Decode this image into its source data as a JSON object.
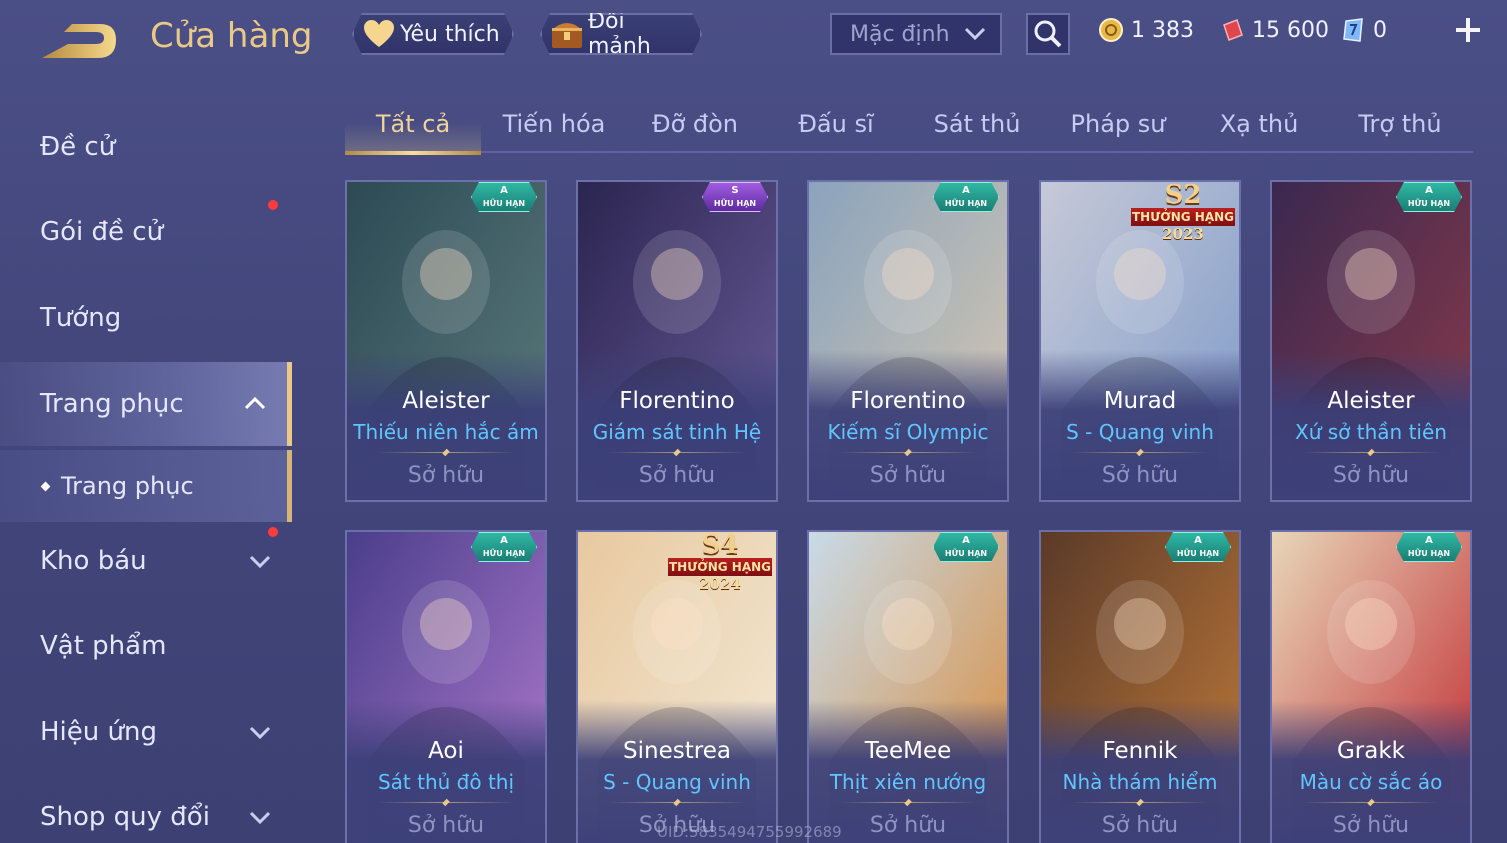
{
  "header": {
    "title": "Cửa hàng",
    "favorites_label": "Yêu thích",
    "exchange_label": "Đổi mảnh",
    "sort_value": "Mặc định",
    "currencies": [
      {
        "name": "gold-coin",
        "value": "1 383",
        "color": "#e8b84a"
      },
      {
        "name": "red-voucher",
        "value": "15 600",
        "color": "#e0464e"
      },
      {
        "name": "blue-gem",
        "value": "0",
        "color": "#7fb8ff"
      }
    ]
  },
  "sidebar": {
    "items": [
      {
        "label": "Đề cử"
      },
      {
        "label": "Gói đề cử",
        "dot": true
      },
      {
        "label": "Tướng"
      },
      {
        "label": "Trang phục",
        "expanded": true
      },
      {
        "label": "Trang phục",
        "sub": true
      },
      {
        "label": "Kho báu",
        "dot": true
      },
      {
        "label": "Vật phẩm"
      },
      {
        "label": "Hiệu ứng"
      },
      {
        "label": "Shop quy đổi"
      }
    ]
  },
  "tabs": [
    "Tất cả",
    "Tiến hóa",
    "Đỡ đòn",
    "Đấu sĩ",
    "Sát thủ",
    "Pháp sư",
    "Xạ thủ",
    "Trợ thủ"
  ],
  "active_tab": "Tất cả",
  "cards": [
    {
      "hero": "Aleister",
      "skin": "Thiếu niên hắc ám",
      "status": "Sở hữu",
      "badge": "A",
      "badge_sub": "HỮU HẠN",
      "color1": "#2d4a55",
      "color2": "#5c7b7c"
    },
    {
      "hero": "Florentino",
      "skin": "Giám sát tinh Hệ",
      "status": "Sở hữu",
      "badge": "S",
      "badge_sub": "HỮU HẠN",
      "color1": "#2b2550",
      "color2": "#6a5c9a"
    },
    {
      "hero": "Florentino",
      "skin": "Kiếm sĩ Olympic",
      "status": "Sở hữu",
      "badge": "A",
      "badge_sub": "HỮU HẠN",
      "color1": "#8aa3bd",
      "color2": "#d7c8b0"
    },
    {
      "hero": "Murad",
      "skin": "S - Quang vinh",
      "status": "Sở hữu",
      "rank_big": "S2",
      "rank_label": "THƯỞNG HẠNG",
      "rank_year": "2023",
      "color1": "#c6c9d8",
      "color2": "#7d9ac8"
    },
    {
      "hero": "Aleister",
      "skin": "Xứ sở thần tiên",
      "status": "Sở hữu",
      "badge": "A",
      "badge_sub": "HỮU HẠN",
      "color1": "#3a2850",
      "color2": "#8a3a4a"
    },
    {
      "hero": "Aoi",
      "skin": "Sát thủ đô thị",
      "status": "Sở hữu",
      "badge": "A",
      "badge_sub": "HỮU HẠN",
      "color1": "#4a3e8a",
      "color2": "#b07ad0"
    },
    {
      "hero": "Sinestrea",
      "skin": "S - Quang vinh",
      "status": "Sở hữu",
      "rank_big": "S4",
      "rank_label": "THƯỞNG HẠNG",
      "rank_year": "2024",
      "color1": "#e8c9a0",
      "color2": "#f3ead8"
    },
    {
      "hero": "TeeMee",
      "skin": "Thịt xiên nướng",
      "status": "Sở hữu",
      "badge": "A",
      "badge_sub": "HỮU HẠN",
      "color1": "#c8dbe8",
      "color2": "#d88a3a"
    },
    {
      "hero": "Fennik",
      "skin": "Nhà thám hiểm",
      "status": "Sở hữu",
      "badge": "A",
      "badge_sub": "HỮU HẠN",
      "color1": "#5a3a28",
      "color2": "#c07a3a"
    },
    {
      "hero": "Grakk",
      "skin": "Màu cờ sắc áo",
      "status": "Sở hữu",
      "badge": "A",
      "badge_sub": "HỮU HẠN",
      "color1": "#e7d6b8",
      "color2": "#c0262e"
    }
  ],
  "uid": "UID:58354947559926​89"
}
